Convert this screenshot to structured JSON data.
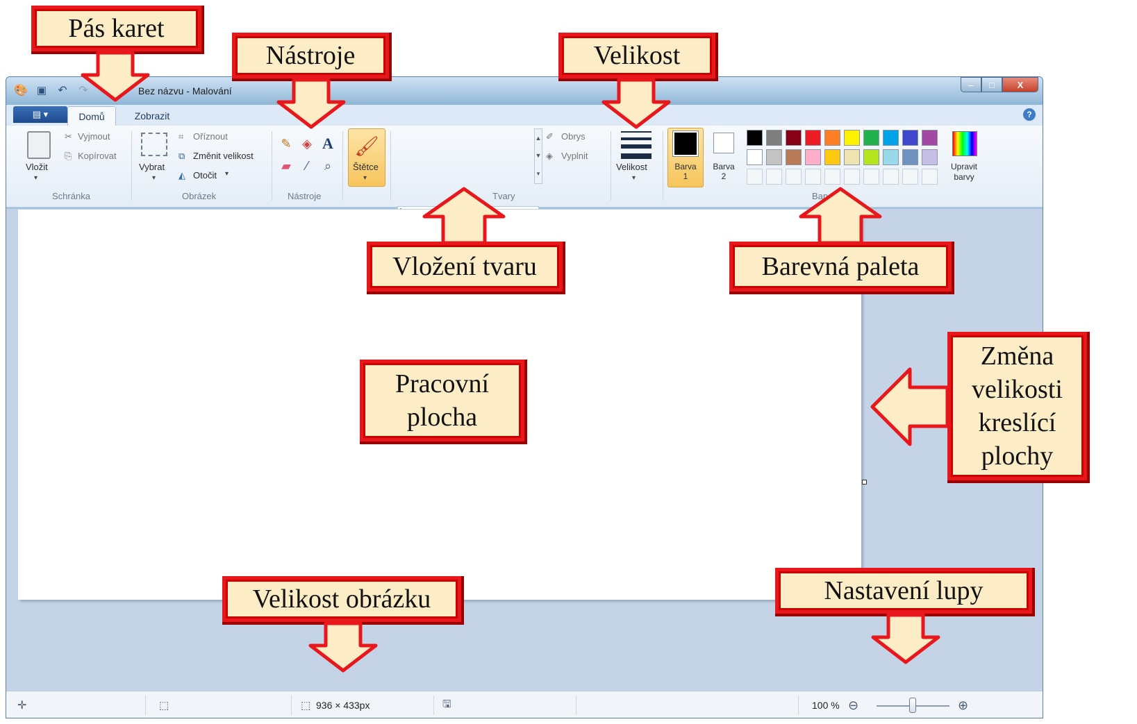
{
  "window": {
    "title": "Bez názvu - Malování",
    "buttons": {
      "minimize": "–",
      "maximize": "□",
      "close": "X"
    }
  },
  "ribbon": {
    "file_menu_label": "▤ ▾",
    "tabs": [
      {
        "label": "Domů"
      },
      {
        "label": "Zobrazit"
      }
    ],
    "groups": {
      "clipboard": {
        "name": "Schránka",
        "paste": "Vložit",
        "cut": "Vyjmout",
        "copy": "Kopírovat"
      },
      "image": {
        "name": "Obrázek",
        "select": "Vybrat",
        "crop": "Oříznout",
        "resize": "Změnit velikost",
        "rotate": "Otočit"
      },
      "tools": {
        "name": "Nástroje"
      },
      "brushes": {
        "label": "Štětce"
      },
      "shapes": {
        "name": "Tvary",
        "outline": "Obrys",
        "fill": "Vyplnit"
      },
      "size": {
        "label": "Velikost"
      },
      "colors": {
        "name": "Barvy",
        "color1": "Barva 1",
        "color2": "Barva 2",
        "edit": "Upravit barvy",
        "palette_row1": [
          "#000000",
          "#7f7f7f",
          "#880015",
          "#ed1c24",
          "#ff7f27",
          "#fff200",
          "#22b14c",
          "#00a2e8",
          "#3f48cc",
          "#a349a4"
        ],
        "palette_row2": [
          "#ffffff",
          "#c3c3c3",
          "#b97a57",
          "#ffaec9",
          "#ffc90e",
          "#efe4b0",
          "#b5e61d",
          "#99d9ea",
          "#7092be",
          "#c8bfe7"
        ]
      }
    }
  },
  "statusbar": {
    "image_size": "936 × 433px",
    "zoom": "100 %"
  },
  "callouts": {
    "ribbon": "Pás karet",
    "tools": "Nástroje",
    "size": "Velikost",
    "insert_shape": "Vložení tvaru",
    "palette": "Barevná paleta",
    "workspace": "Pracovní plocha",
    "resize_canvas": "Změna velikosti kreslící plochy",
    "image_size": "Velikost obrázku",
    "zoom": "Nastavení lupy"
  }
}
